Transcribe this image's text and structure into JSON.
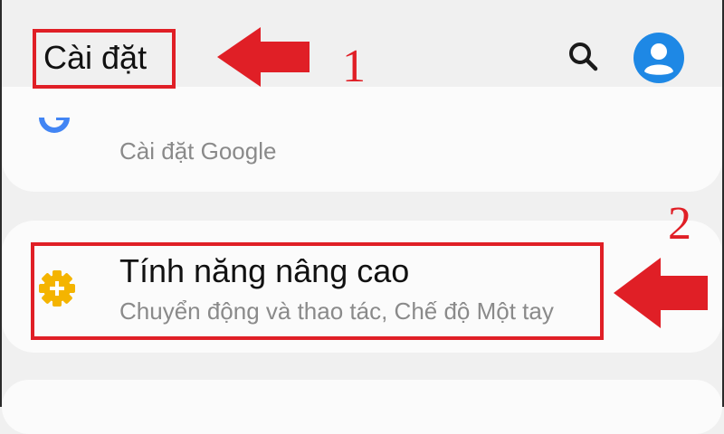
{
  "header": {
    "title": "Cài đặt"
  },
  "annotations": {
    "step1": "1",
    "step2": "2",
    "color": "#e01f26"
  },
  "icons": {
    "search": "search-icon",
    "account": "account-icon",
    "google": "google-icon",
    "advanced": "gear-plus-icon"
  },
  "settings": {
    "google": {
      "subtitle": "Cài đặt Google"
    },
    "advanced": {
      "title": "Tính năng nâng cao",
      "subtitle": "Chuyển động và thao tác, Chế độ Một tay"
    }
  },
  "colors": {
    "background": "#f0f0f0",
    "card": "#fbfbfb",
    "avatar": "#1e88e5",
    "gear": "#f4b400"
  }
}
